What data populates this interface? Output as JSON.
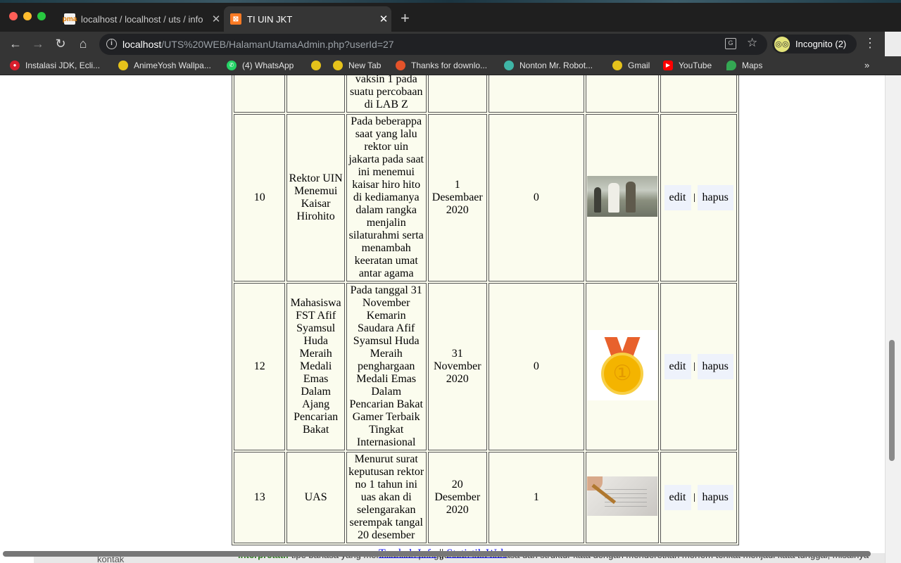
{
  "browser": {
    "tabs": [
      {
        "title": "localhost / localhost / uts / info",
        "active": false,
        "favicon": "phpmyadmin"
      },
      {
        "title": "TI UIN JKT",
        "active": true,
        "favicon": "xampp"
      }
    ],
    "url_host": "localhost",
    "url_path": "/UTS%20WEB/HalamanUtamaAdmin.php?userId=27",
    "profile_label": "Incognito (2)",
    "bookmarks": [
      "Instalasi JDK, Ecli...",
      "AnimeYosh Wallpa...",
      "(4) WhatsApp",
      "",
      "New Tab",
      "Thanks for downlo...",
      "Nonton Mr. Robot...",
      "Gmail",
      "YouTube",
      "Maps"
    ]
  },
  "table": {
    "top_partial_body": "vaksin 1 pada suatu percobaan di LAB Z",
    "rows": [
      {
        "id": "10",
        "judul": "Rektor UIN Menemui Kaisar Hirohito",
        "isi": "Pada beberappa saat yang lalu rektor uin jakarta pada saat ini menemui kaisar hiro hito di kediamanya dalam rangka menjalin silaturahmi serta menambah keeratan umat antar agama",
        "tanggal": "1 Desembaer 2020",
        "dilihat": "0",
        "image": "historic-photo"
      },
      {
        "id": "12",
        "judul": "Mahasiswa FST Afif Syamsul Huda Meraih Medali Emas Dalam Ajang Pencarian Bakat",
        "isi": "Pada tanggal 31 November Kemarin Saudara Afif Syamsul Huda Meraih penghargaan Medali Emas Dalam Pencarian Bakat Gamer Terbaik Tingkat Internasional",
        "tanggal": "31 November 2020",
        "dilihat": "0",
        "image": "gold-medal"
      },
      {
        "id": "13",
        "judul": "UAS",
        "isi": "Menurut surat keputusan rektor no 1 tahun ini uas akan di selengarakan serempak tangal 20 desember",
        "tanggal": "20 Desember 2020",
        "dilihat": "1",
        "image": "exam-paper"
      }
    ],
    "edit_label": "edit",
    "delete_label": "hapus"
  },
  "footer": {
    "add_info": "Tambah Info",
    "separator": "||",
    "stats": "Statistik Web"
  },
  "underlying": {
    "kontak": "kontak",
    "term": "interpretatif",
    "text": " tipe bahasa yang menekankan penggunaan tata bahasa dan struktur kata dengan menderetkan morfem terikat menjadi kata tunggal, misalnya"
  }
}
